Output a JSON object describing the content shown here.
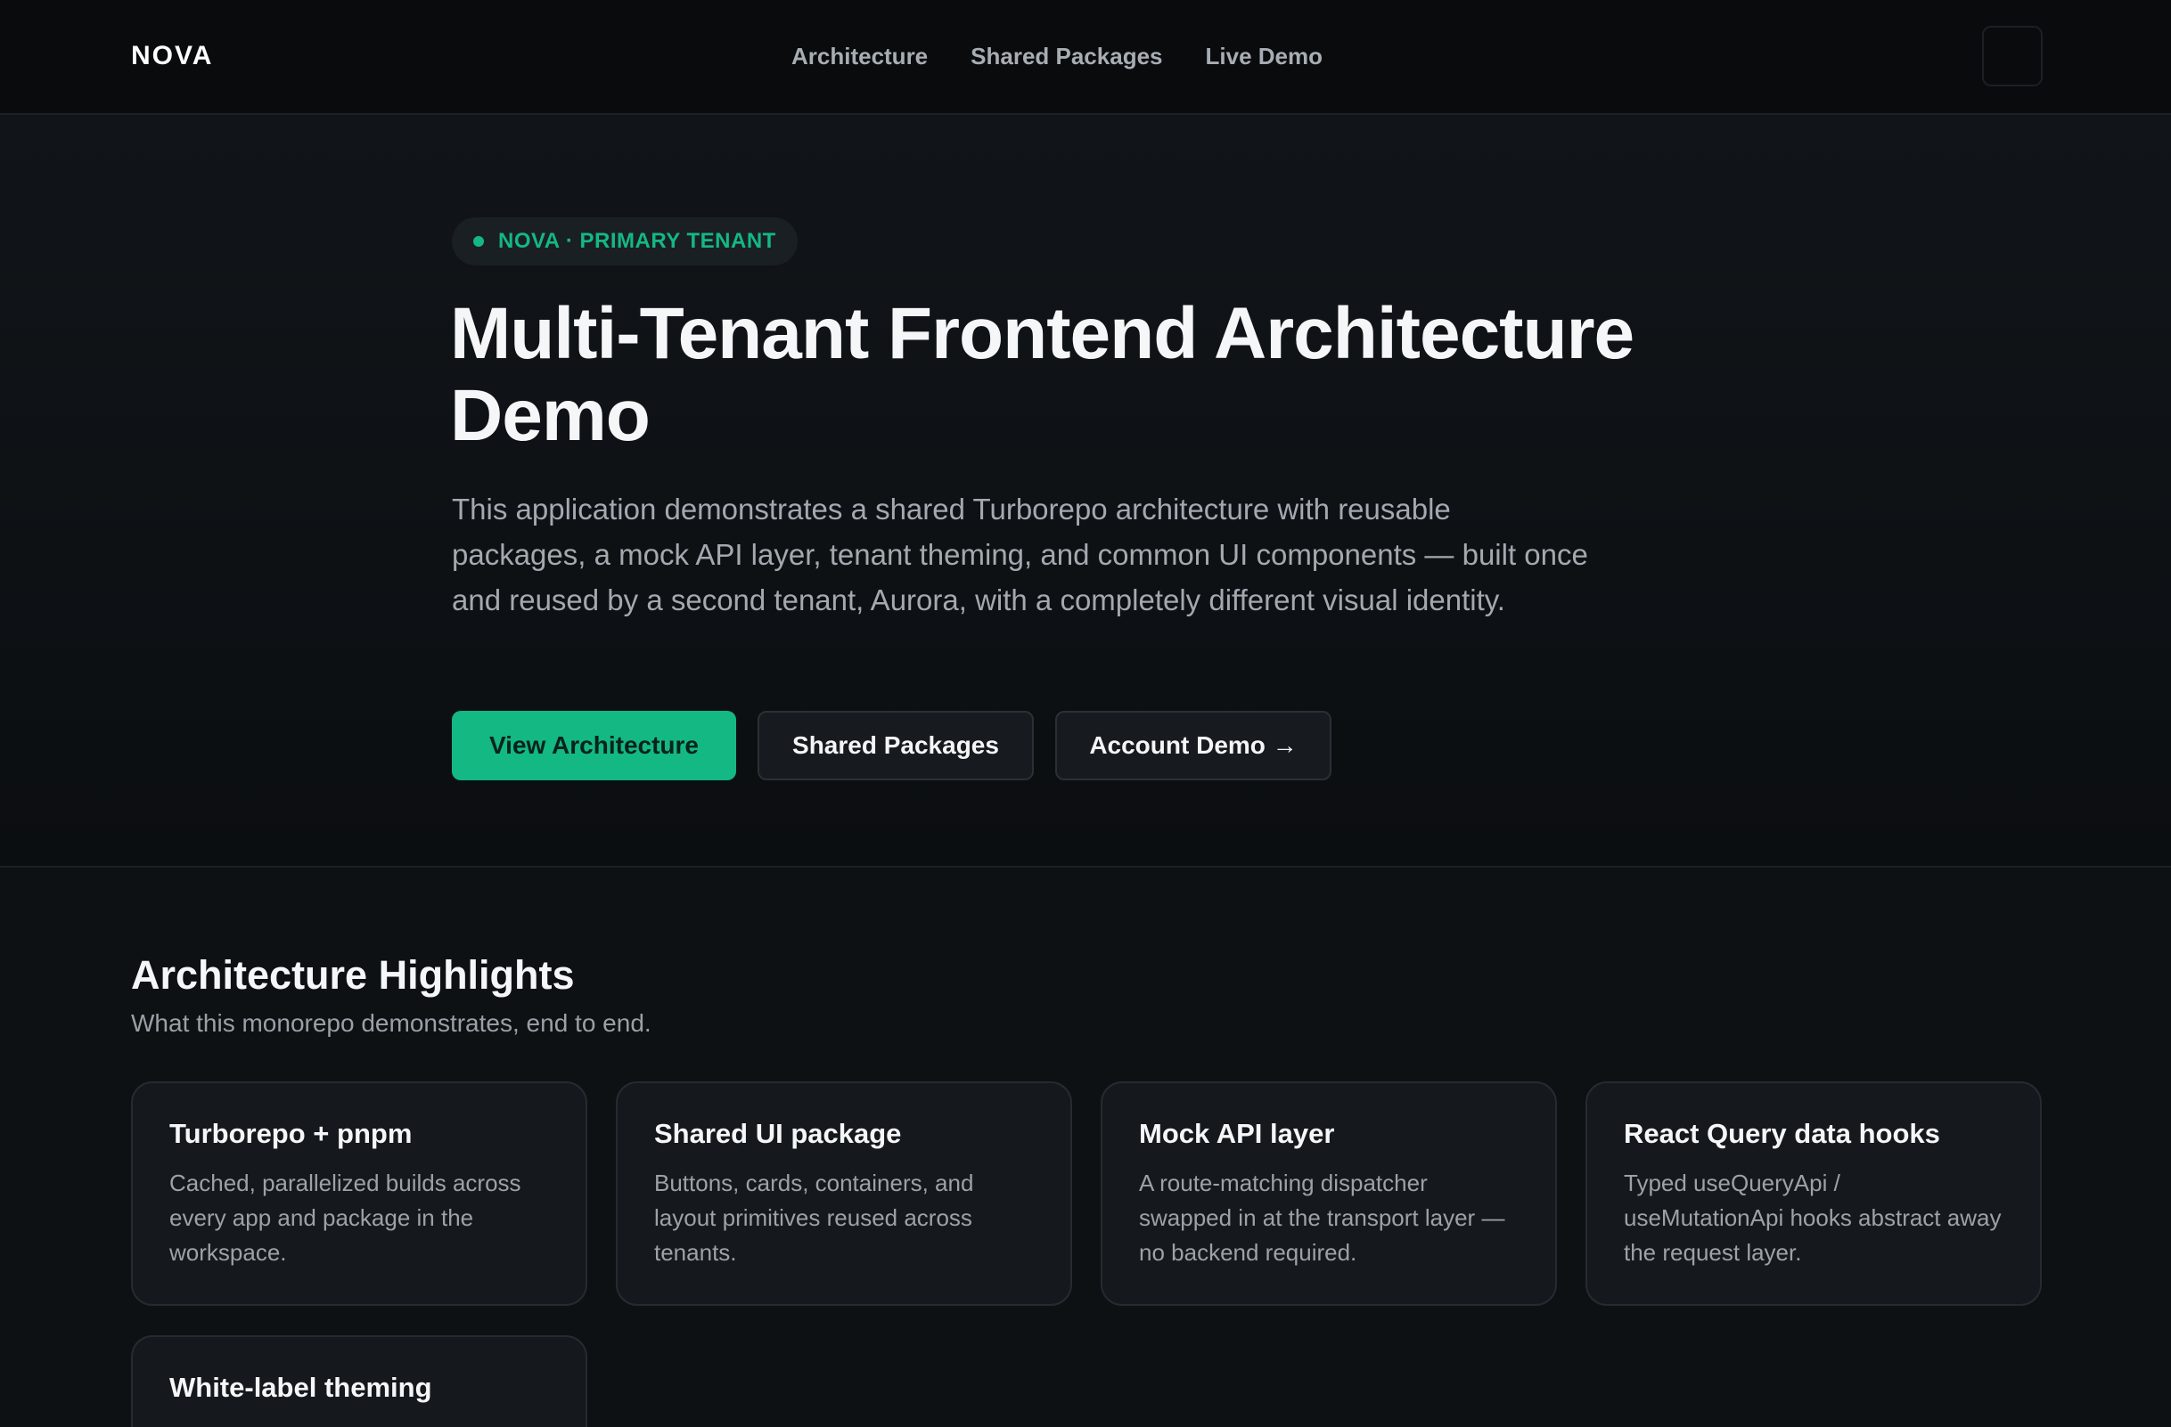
{
  "nav": {
    "brand": "NOVA",
    "links": [
      "Architecture",
      "Shared Packages",
      "Live Demo"
    ],
    "menu_icon": "menu-icon"
  },
  "hero": {
    "badge": "NOVA · PRIMARY TENANT",
    "title": "Multi-Tenant Frontend Architecture Demo",
    "description": "This application demonstrates a shared Turborepo architecture with reusable packages, a mock API layer, tenant theming, and common UI components — built once and reused by a second tenant, Aurora, with a completely different visual identity.",
    "buttons": {
      "primary": "View Architecture",
      "packages": "Shared Packages",
      "demo": "Account Demo →"
    }
  },
  "highlights": {
    "title": "Architecture Highlights",
    "subtitle": "What this monorepo demonstrates, end to end.",
    "cards": [
      {
        "title": "Turborepo + pnpm",
        "desc": "Cached, parallelized builds across every app and package in the workspace."
      },
      {
        "title": "Shared UI package",
        "desc": "Buttons, cards, containers, and layout primitives reused across tenants."
      },
      {
        "title": "Mock API layer",
        "desc": "A route-matching dispatcher swapped in at the transport layer — no backend required."
      },
      {
        "title": "React Query data hooks",
        "desc": "Typed useQueryApi / useMutationApi hooks abstract away the request layer."
      },
      {
        "title": "White-label theming",
        "desc": ""
      }
    ]
  },
  "colors": {
    "accent": "#14b883",
    "background": "#0d1114",
    "nav_background": "#090b0d",
    "card_background": "#15191d"
  }
}
